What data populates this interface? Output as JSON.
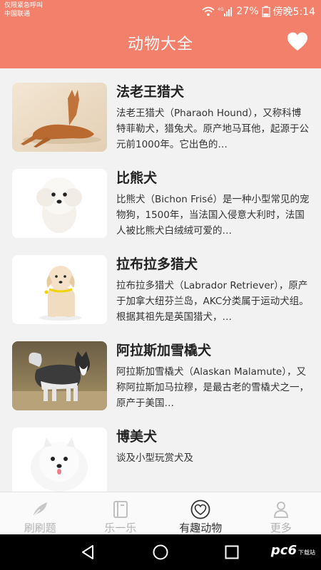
{
  "status_bar": {
    "carrier_line1": "仅限紧急呼叫",
    "carrier_line2": "中国联通",
    "battery": "27%",
    "time": "傍晚5:14"
  },
  "header": {
    "title": "动物大全",
    "favorite_icon": "heart-icon"
  },
  "animals": [
    {
      "name": "法老王猎犬",
      "desc": "法老王猎犬（Pharaoh Hound），又称科博特菲勒犬，猎兔犬。原产地马耳他，起源于公元前1000年。它出色的…"
    },
    {
      "name": "比熊犬",
      "desc": "比熊犬（Bichon Frisé）是一种小型常见的宠物狗，1500年，当法国入侵意大利时，法国人被比熊犬白绒绒可爱的…"
    },
    {
      "name": "拉布拉多猎犬",
      "desc": "拉布拉多猎犬（Labrador Retriever），原产于加拿大纽芬兰岛，AKC分类属于运动犬组。根据其祖先是英国猎犬，…"
    },
    {
      "name": "阿拉斯加雪橇犬",
      "desc": "阿拉斯加雪橇犬（Alaskan Malamute），又称阿拉斯加马拉穆，是最古老的雪橇犬之一，原产于美国…"
    },
    {
      "name": "博美犬",
      "desc": "谈及小型玩赏犬及"
    }
  ],
  "tabs": [
    {
      "label": "刷刷题",
      "icon": "feather-icon",
      "active": false
    },
    {
      "label": "乐一乐",
      "icon": "book-icon",
      "active": false
    },
    {
      "label": "有趣动物",
      "icon": "heart-circle-icon",
      "active": true
    },
    {
      "label": "更多",
      "icon": "person-icon",
      "active": false
    }
  ],
  "watermark": {
    "text": "pc6",
    "sub": "下载站"
  }
}
